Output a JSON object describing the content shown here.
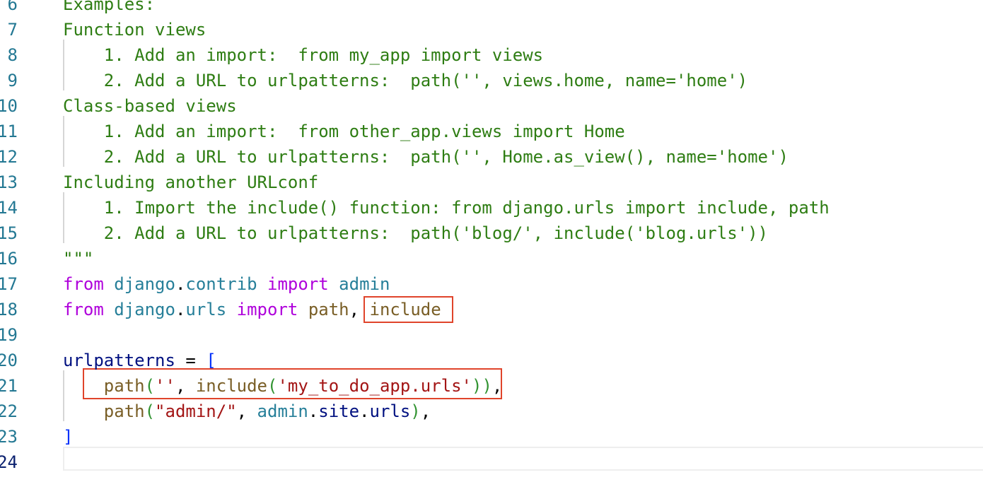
{
  "editor": {
    "lines": [
      {
        "n": "6",
        "tokens": [
          {
            "t": "Examples:",
            "c": "doc"
          }
        ]
      },
      {
        "n": "7",
        "tokens": [
          {
            "t": "Function views",
            "c": "doc"
          }
        ]
      },
      {
        "n": "8",
        "tokens": [
          {
            "t": "    1. Add an import:  from my_app import views",
            "c": "doc"
          }
        ]
      },
      {
        "n": "9",
        "tokens": [
          {
            "t": "    2. Add a URL to urlpatterns:  path('', views.home, name='home')",
            "c": "doc"
          }
        ]
      },
      {
        "n": "10",
        "tokens": [
          {
            "t": "Class-based views",
            "c": "doc"
          }
        ]
      },
      {
        "n": "11",
        "tokens": [
          {
            "t": "    1. Add an import:  from other_app.views import Home",
            "c": "doc"
          }
        ]
      },
      {
        "n": "12",
        "tokens": [
          {
            "t": "    2. Add a URL to urlpatterns:  path('', Home.as_view(), name='home')",
            "c": "doc"
          }
        ]
      },
      {
        "n": "13",
        "tokens": [
          {
            "t": "Including another URLconf",
            "c": "doc"
          }
        ]
      },
      {
        "n": "14",
        "tokens": [
          {
            "t": "    1. Import the include() function: from django.urls import include, path",
            "c": "doc"
          }
        ]
      },
      {
        "n": "15",
        "tokens": [
          {
            "t": "    2. Add a URL to urlpatterns:  path('blog/', include('blog.urls'))",
            "c": "doc"
          }
        ]
      },
      {
        "n": "16",
        "tokens": [
          {
            "t": "\"\"\"",
            "c": "doc"
          }
        ]
      },
      {
        "n": "17",
        "tokens": [
          {
            "t": "from",
            "c": "kw"
          },
          {
            "t": " ",
            "c": "pl"
          },
          {
            "t": "django",
            "c": "mod"
          },
          {
            "t": ".",
            "c": "pl"
          },
          {
            "t": "contrib",
            "c": "mod"
          },
          {
            "t": " ",
            "c": "pl"
          },
          {
            "t": "import",
            "c": "kw"
          },
          {
            "t": " ",
            "c": "pl"
          },
          {
            "t": "admin",
            "c": "mod"
          }
        ]
      },
      {
        "n": "18",
        "tokens": [
          {
            "t": "from",
            "c": "kw"
          },
          {
            "t": " ",
            "c": "pl"
          },
          {
            "t": "django",
            "c": "mod"
          },
          {
            "t": ".",
            "c": "pl"
          },
          {
            "t": "urls",
            "c": "mod"
          },
          {
            "t": " ",
            "c": "pl"
          },
          {
            "t": "import",
            "c": "kw"
          },
          {
            "t": " ",
            "c": "pl"
          },
          {
            "t": "path",
            "c": "fn"
          },
          {
            "t": ", ",
            "c": "pl"
          },
          {
            "t": "include",
            "c": "fn"
          }
        ]
      },
      {
        "n": "19",
        "tokens": []
      },
      {
        "n": "20",
        "tokens": [
          {
            "t": "urlpatterns",
            "c": "var"
          },
          {
            "t": " = ",
            "c": "pl"
          },
          {
            "t": "[",
            "c": "br1"
          }
        ]
      },
      {
        "n": "21",
        "tokens": [
          {
            "t": "    ",
            "c": "pl"
          },
          {
            "t": "path",
            "c": "fn"
          },
          {
            "t": "(",
            "c": "br2"
          },
          {
            "t": "''",
            "c": "str"
          },
          {
            "t": ", ",
            "c": "pl"
          },
          {
            "t": "include",
            "c": "fn"
          },
          {
            "t": "(",
            "c": "br2"
          },
          {
            "t": "'my_to_do_app.urls'",
            "c": "str"
          },
          {
            "t": "))",
            "c": "br2"
          },
          {
            "t": ",",
            "c": "pl"
          }
        ]
      },
      {
        "n": "22",
        "tokens": [
          {
            "t": "    ",
            "c": "pl"
          },
          {
            "t": "path",
            "c": "fn"
          },
          {
            "t": "(",
            "c": "br2"
          },
          {
            "t": "\"admin/\"",
            "c": "str"
          },
          {
            "t": ", ",
            "c": "pl"
          },
          {
            "t": "admin",
            "c": "mod"
          },
          {
            "t": ".",
            "c": "pl"
          },
          {
            "t": "site",
            "c": "var"
          },
          {
            "t": ".",
            "c": "pl"
          },
          {
            "t": "urls",
            "c": "var"
          },
          {
            "t": ")",
            "c": "br2"
          },
          {
            "t": ",",
            "c": "pl"
          }
        ]
      },
      {
        "n": "23",
        "tokens": [
          {
            "t": "]",
            "c": "br1"
          }
        ]
      },
      {
        "n": "24",
        "tokens": [],
        "active": true
      }
    ]
  },
  "colors": {
    "docstring": "#2e7d13",
    "keyword": "#af00db",
    "module": "#267f99",
    "variable": "#001080",
    "function": "#795e26",
    "string": "#a31515",
    "line_number": "#237893",
    "highlight_box": "#e0442b"
  }
}
